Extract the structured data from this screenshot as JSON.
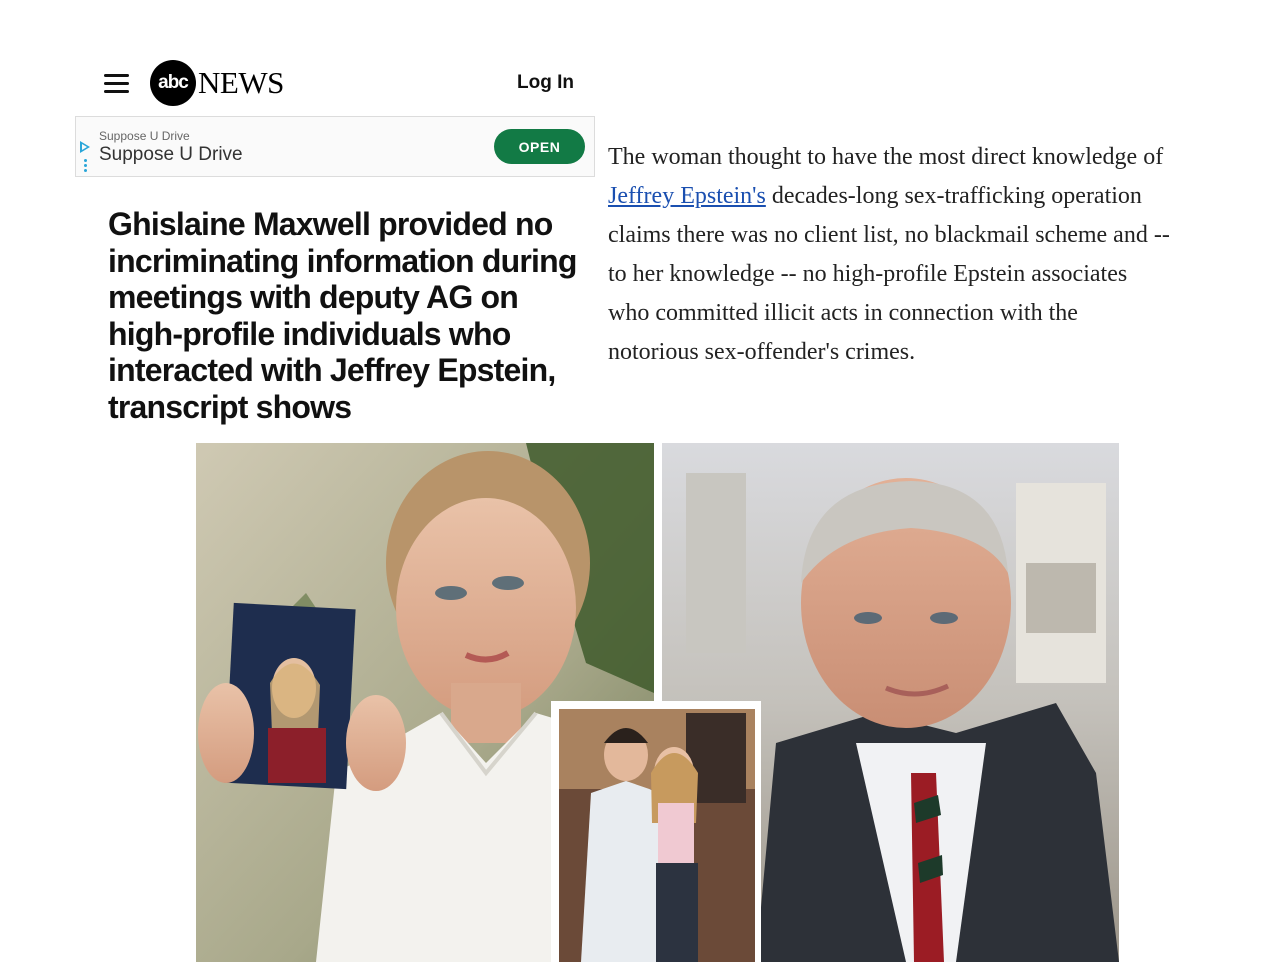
{
  "header": {
    "logo_mark": "abc",
    "logo_text": "NEWS",
    "login_label": "Log In",
    "menu_icon": "hamburger-menu-icon"
  },
  "ad": {
    "sponsor_small": "Suppose U Drive",
    "sponsor_title": "Suppose U Drive",
    "cta_label": "OPEN",
    "cta_color": "#127a45",
    "icons": [
      "ad-choices-play-icon",
      "ad-more-options-icon"
    ]
  },
  "article": {
    "headline": "Ghislaine Maxwell provided no incriminating information during meetings with deputy AG on high-profile individuals who interacted with Jeffrey Epstein, transcript shows",
    "lead_before_link": "The woman thought to have the most direct knowledge of ",
    "lead_link": "Jeffrey Epstein's",
    "lead_after_link": " decades-long sex-trafficking operation claims there was no client list, no blackmail scheme and -- to her knowledge -- no high-profile Epstein associates who committed illicit acts in connection with the notorious sex-offender's crimes.",
    "link_color": "#1a4fb0"
  }
}
